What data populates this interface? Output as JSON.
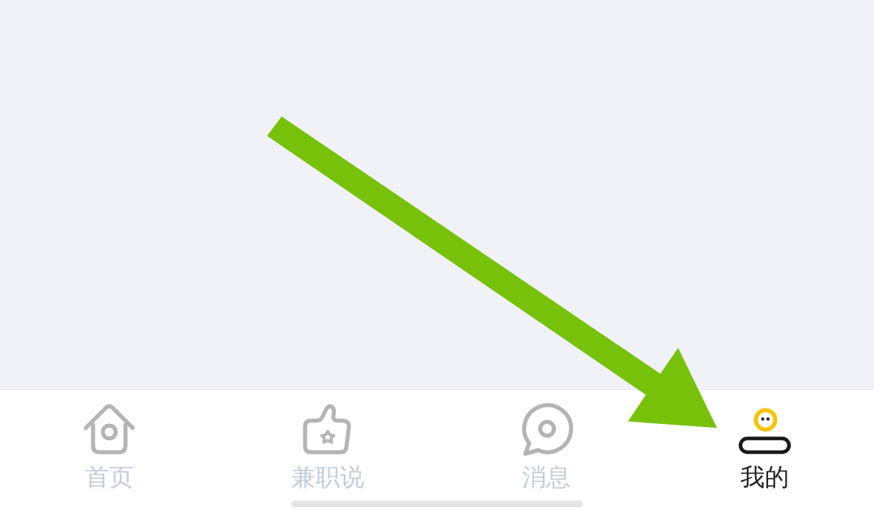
{
  "tab_bar": {
    "tabs": [
      {
        "kind": "home",
        "label": "首页",
        "selected": false
      },
      {
        "kind": "likes",
        "label": "兼职说",
        "selected": false
      },
      {
        "kind": "messages",
        "label": "消息",
        "selected": false
      },
      {
        "kind": "profile",
        "label": "我的",
        "selected": true
      }
    ]
  }
}
